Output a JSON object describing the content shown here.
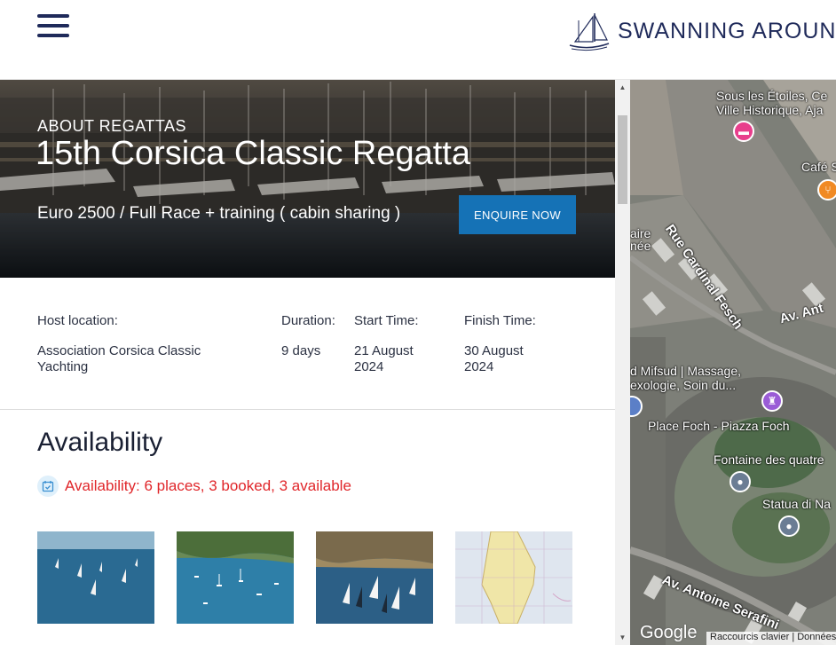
{
  "header": {
    "brand": "SWANNING AROUND",
    "menu_icon": "hamburger-menu-icon"
  },
  "hero": {
    "eyebrow": "ABOUT REGATTAS",
    "title": "15th Corsica Classic Regatta",
    "price": "Euro 2500 / Full Race + training ( cabin sharing )",
    "cta_label": "ENQUIRE NOW"
  },
  "details": {
    "host_label": "Host location:",
    "host_value": "Association Corsica Classic Yachting",
    "duration_label": "Duration:",
    "duration_value": "9 days",
    "start_label": "Start Time:",
    "start_value": "21 August 2024",
    "finish_label": "Finish Time:",
    "finish_value": "30 August 2024"
  },
  "availability": {
    "heading": "Availability",
    "status": "Availability: 6 places, 3 booked, 3 available",
    "icon": "calendar-check-icon"
  },
  "gallery": {
    "images": [
      "sailing-boats-open-sea",
      "yachts-anchored-bay",
      "regatta-sails-coast",
      "corsica-nautical-map"
    ]
  },
  "map": {
    "labels": {
      "hotel": "Sous les Étoiles, Ce Ville Historique, Aja",
      "cafe": "Café S",
      "street1": "Rue Cardinal Fesch",
      "street2": "Av. Ant",
      "left1": "aire",
      "left2": "née",
      "massage": "d Mifsud | Massage, exologie, Soin du...",
      "place": "Place Foch - Piazza Foch",
      "fountain": "Fontaine des quatre",
      "statue": "Statua di Na",
      "street3": "Av. Antoine Serafini"
    },
    "google": "Google",
    "shortcuts": "Raccourcis clavier",
    "data": "Données"
  },
  "colors": {
    "brand_navy": "#1f2a5a",
    "cta_blue": "#1572b6",
    "availability_red": "#e0262a"
  }
}
